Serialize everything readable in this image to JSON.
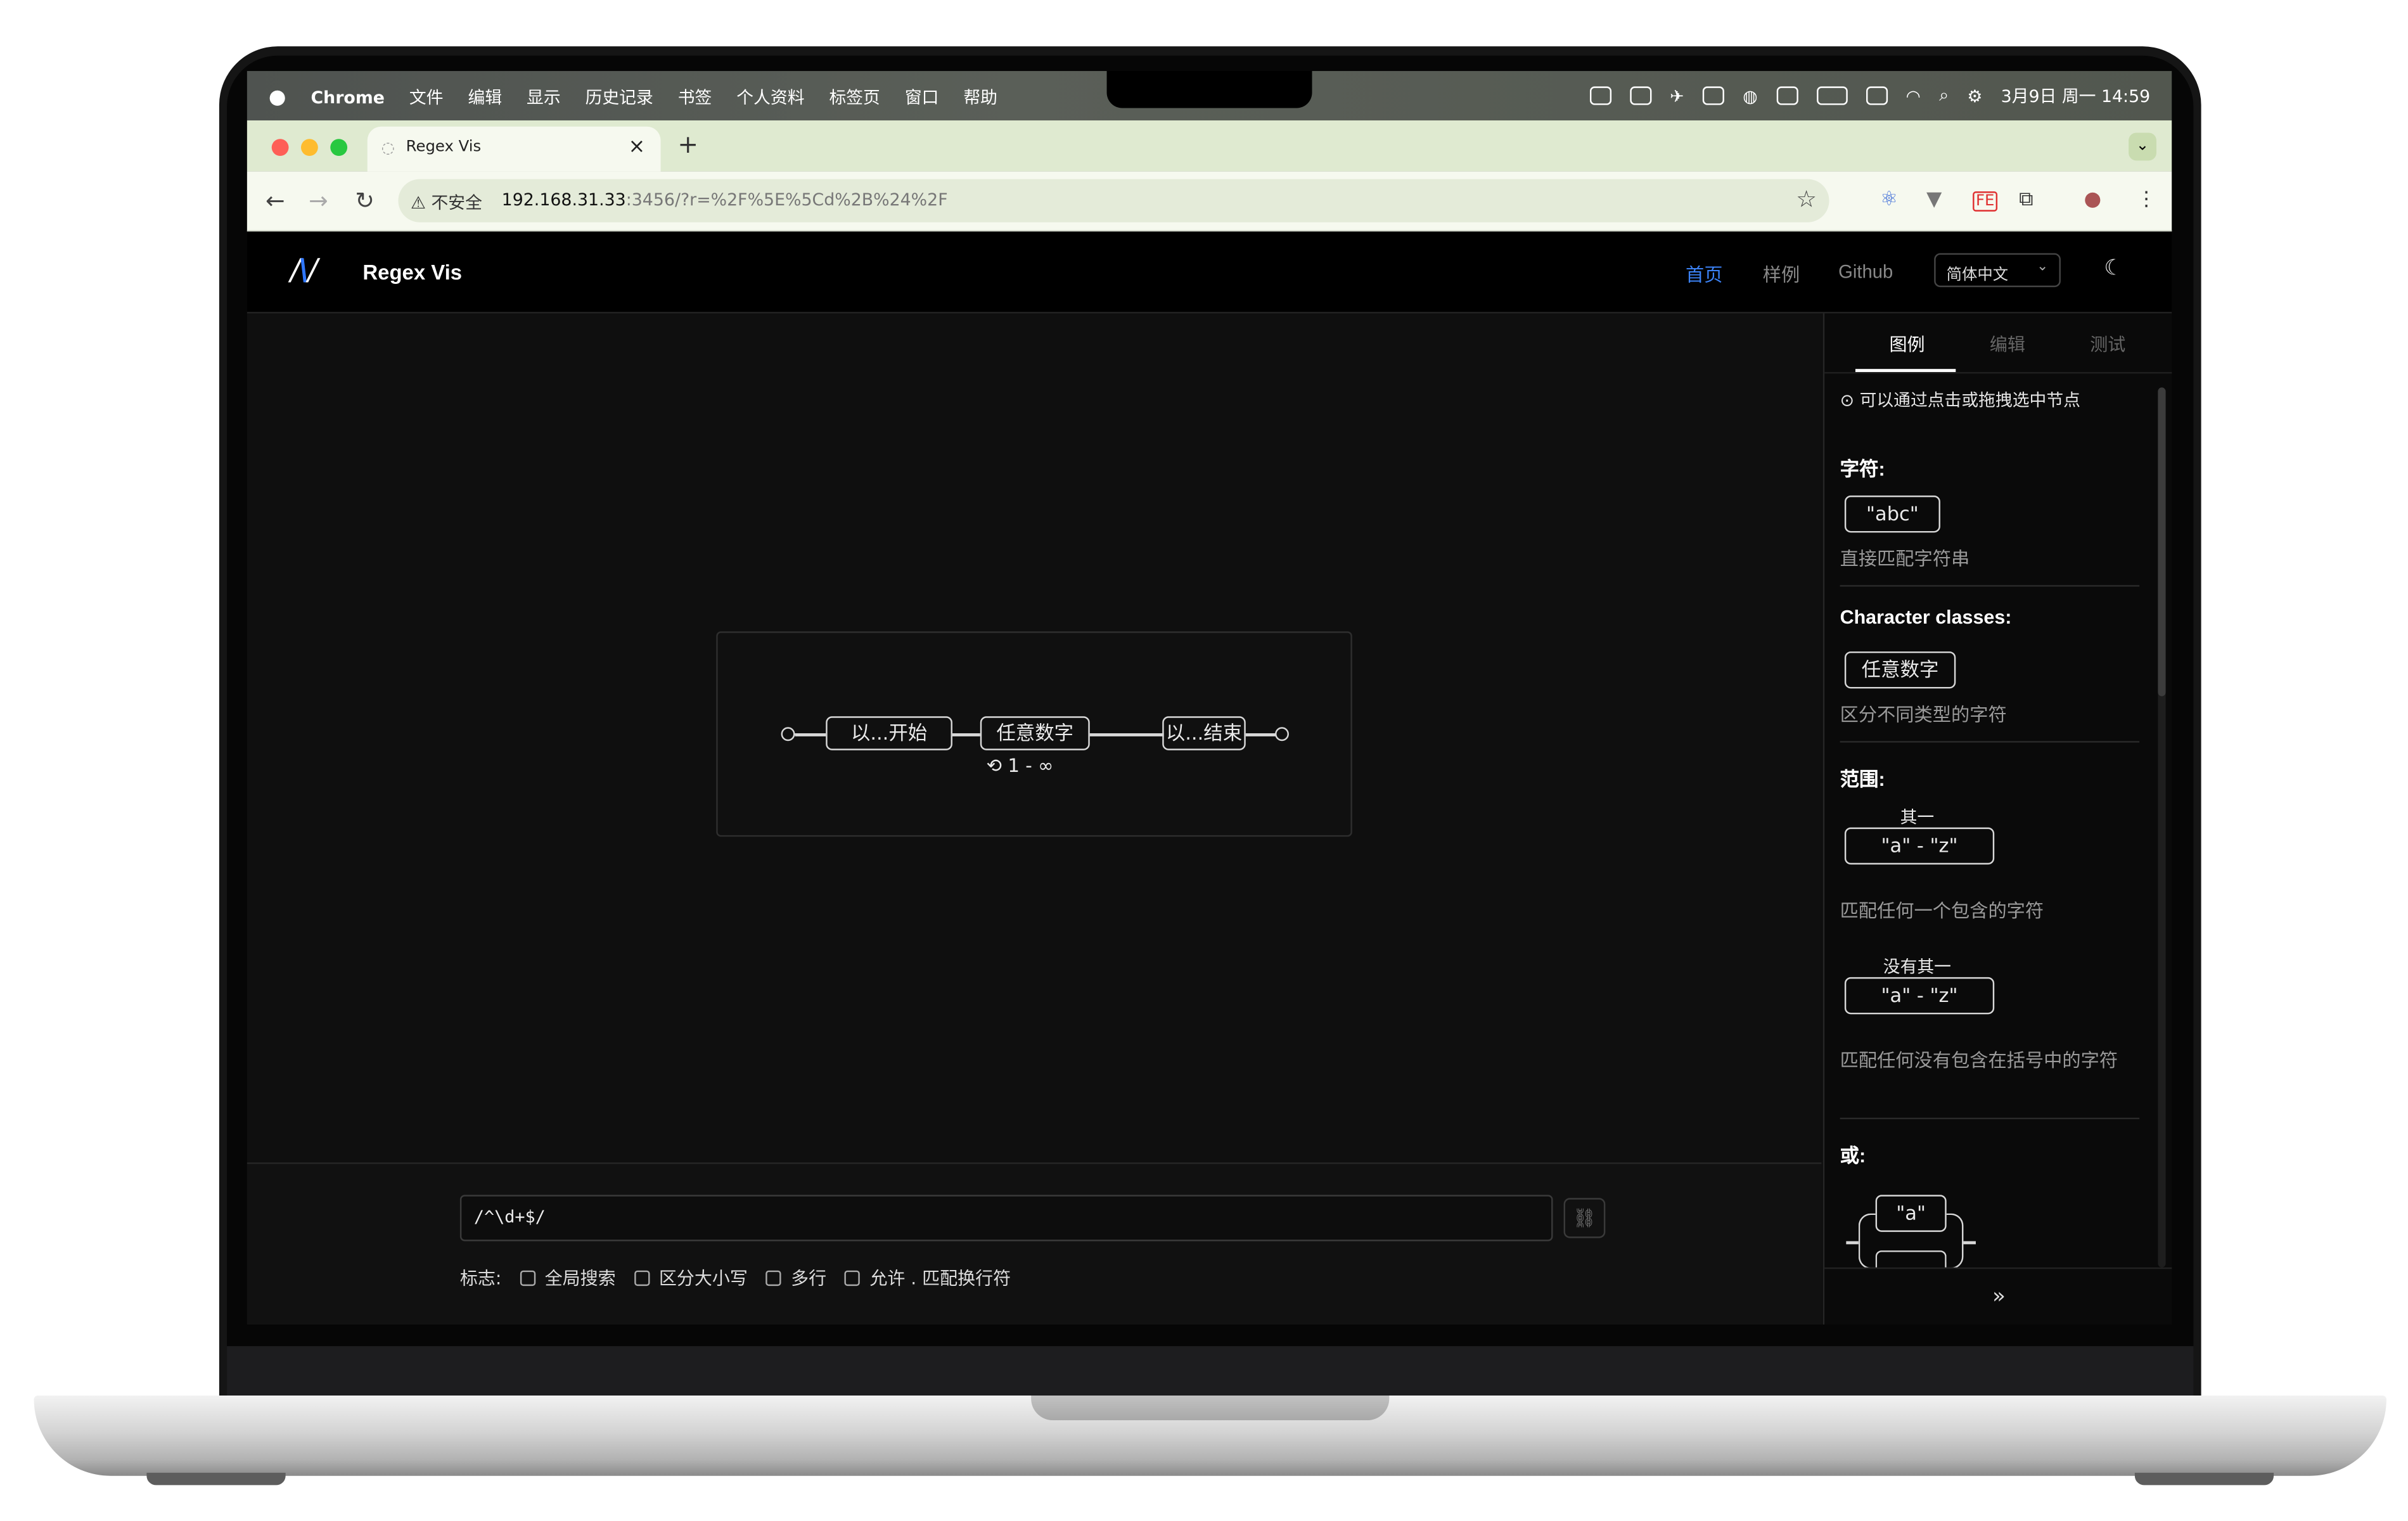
{
  "menubar": {
    "app": "Chrome",
    "menus": [
      "文件",
      "编辑",
      "显示",
      "历史记录",
      "书签",
      "个人资料",
      "标签页",
      "窗口",
      "帮助"
    ],
    "datetime": "3月9日 周一  14:59"
  },
  "browser": {
    "tab_title": "Regex Vis",
    "security_label": "不安全",
    "url_host": "192.168.31.33",
    "url_rest": ":3456/?r=%2F%5E%5Cd%2B%24%2F"
  },
  "app": {
    "brand": "Regex Vis",
    "nav": {
      "home": "首页",
      "examples": "样例",
      "github": "Github"
    },
    "language": "简体中文"
  },
  "diagram": {
    "start_node": "以...开始",
    "digit_node": "任意数字",
    "end_node": "以...结束",
    "quantifier": "1 - ∞"
  },
  "editor": {
    "regex_value": "/^\\d+$/",
    "flags_label": "标志:",
    "flags": [
      "全局搜索",
      "区分大小写",
      "多行",
      "允许 . 匹配换行符"
    ]
  },
  "sidebar": {
    "tabs": [
      "图例",
      "编辑",
      "测试"
    ],
    "hint": "可以通过点击或拖拽选中节点",
    "sections": {
      "chars_title": "字符:",
      "chars_example": "\"abc\"",
      "chars_desc": "直接匹配字符串",
      "classes_title": "Character classes:",
      "classes_example": "任意数字",
      "classes_desc": "区分不同类型的字符",
      "range_title": "范围:",
      "range_caption": "其一",
      "range_example": "\"a\" - \"z\"",
      "range_desc": "匹配任何一个包含的字符",
      "neg_caption": "没有其一",
      "neg_example": "\"a\" - \"z\"",
      "neg_desc": "匹配任何没有包含在括号中的字符",
      "or_title": "或:",
      "or_example": "\"a\""
    },
    "collapse": "»"
  }
}
